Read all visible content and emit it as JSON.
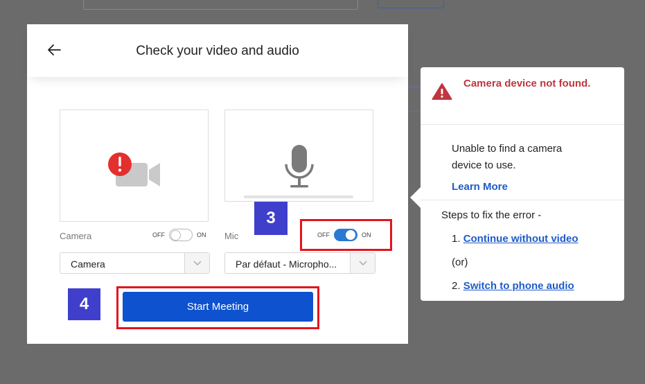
{
  "modal": {
    "title": "Check your video and audio"
  },
  "camera": {
    "label": "Camera",
    "toggle_off": "OFF",
    "toggle_on": "ON",
    "state": "off",
    "select_value": "Camera"
  },
  "mic": {
    "label": "Mic",
    "toggle_off": "OFF",
    "toggle_on": "ON",
    "state": "on",
    "select_value": "Par défaut - Micropho..."
  },
  "start_button": "Start Meeting",
  "annotations": {
    "step3": "3",
    "step4": "4"
  },
  "error_panel": {
    "title": "Camera device not found.",
    "description": "Unable to find a camera device to use.",
    "learn_more": "Learn More",
    "steps_heading": "Steps to fix the error -",
    "step1_num": "1.",
    "step1_link": "Continue without video",
    "or_text": "(or)",
    "step2_num": "2.",
    "step2_link": "Switch to phone audio"
  },
  "colors": {
    "primary": "#0e52cf",
    "toggle_on": "#2a7ad1",
    "error": "#c0353f",
    "annotation_box": "#e3141e",
    "annotation_badge": "#3f3fcc",
    "link": "#1f5cc8"
  },
  "icons": [
    "back-arrow-icon",
    "camera-error-icon",
    "microphone-icon",
    "chevron-down-icon",
    "warning-icon"
  ]
}
